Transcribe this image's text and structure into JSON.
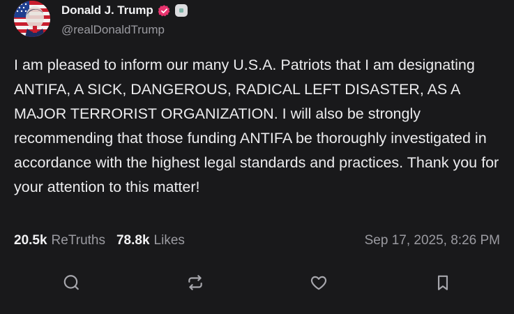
{
  "author": {
    "display_name": "Donald J. Trump",
    "handle": "@realDonaldTrump",
    "verified_icon": "verified-badge-icon",
    "verified_color": "#e8336e",
    "avatar_icon": "avatar-flag-portrait"
  },
  "post": {
    "text": "I am pleased to inform our many U.S.A. Patriots that I am designating ANTIFA, A SICK, DANGEROUS, RADICAL LEFT DISASTER, AS A MAJOR TERRORIST ORGANIZATION. I will also be strongly recommending that those funding ANTIFA be thoroughly investigated in accordance with the highest legal standards and practices. Thank you for your attention to this matter!"
  },
  "stats": {
    "retruths_count": "20.5k",
    "retruths_label": "ReTruths",
    "likes_count": "78.8k",
    "likes_label": "Likes",
    "timestamp": "Sep 17, 2025, 8:26 PM"
  },
  "actions": [
    {
      "name": "reply",
      "icon": "reply-bubble-icon"
    },
    {
      "name": "retruth",
      "icon": "repost-icon"
    },
    {
      "name": "like",
      "icon": "heart-icon"
    },
    {
      "name": "bookmark",
      "icon": "bookmark-icon"
    }
  ],
  "colors": {
    "background": "#19191b",
    "text": "#ececee",
    "muted": "#9b9ba1"
  }
}
